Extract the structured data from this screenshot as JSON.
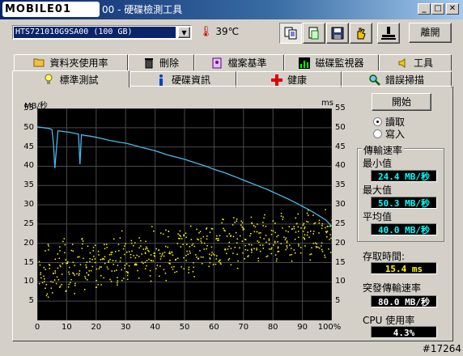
{
  "window": {
    "logo_text": "MOBILE01",
    "title_suffix": "00 - 硬碟檢測工具",
    "btn_min": "_",
    "btn_max": "□",
    "btn_close": "✕"
  },
  "toolbar": {
    "drive": "HTS721010G9SA00 (100 GB)",
    "temperature": "39",
    "temp_unit": "℃",
    "exit_label": "離開"
  },
  "tabs_top": [
    {
      "label": "資料夾使用率",
      "icon": "folder-icon"
    },
    {
      "label": "刪除",
      "icon": "trash-icon"
    },
    {
      "label": "檔案基準",
      "icon": "file-icon"
    },
    {
      "label": "磁碟監視器",
      "icon": "chart-icon"
    },
    {
      "label": "工具",
      "icon": "speaker-icon"
    }
  ],
  "tabs_bottom": [
    {
      "label": "標準測試",
      "icon": "bulb-icon",
      "active": true
    },
    {
      "label": "硬碟資訊",
      "icon": "info-icon"
    },
    {
      "label": "健康",
      "icon": "cross-icon"
    },
    {
      "label": "錯誤掃描",
      "icon": "magnifier-icon"
    }
  ],
  "controls": {
    "start_label": "開始",
    "read_label": "讀取",
    "write_label": "寫入",
    "mode_selected": "read"
  },
  "stats": {
    "transfer_title": "傳輸速率",
    "min_label": "最小值",
    "min_value": "24.4 MB/秒",
    "max_label": "最大值",
    "max_value": "50.3 MB/秒",
    "avg_label": "平均值",
    "avg_value": "40.0 MB/秒",
    "access_label": "存取時間:",
    "access_value": "15.4 ms",
    "burst_label": "突發傳輸速率",
    "burst_value": "80.0 MB/秒",
    "cpu_label": "CPU 使用率",
    "cpu_value": "4.3%"
  },
  "watermark": "#17264",
  "colors": {
    "transfer_line": "#4ab8e8",
    "access_points": "#ffff00",
    "grid": "#4a4a4a",
    "plot_bg": "#000000"
  },
  "chart_data": {
    "type": "line",
    "title": "",
    "ylabel_left": "MB/秒",
    "ylabel_right": "ms",
    "y_left_ticks": [
      5,
      10,
      15,
      20,
      25,
      30,
      35,
      40,
      45,
      50,
      55
    ],
    "y_right_ticks": [
      5,
      10,
      15,
      20,
      25,
      30,
      35,
      40,
      45,
      50,
      55
    ],
    "x_ticks": [
      "0",
      "10",
      "20",
      "30",
      "40",
      "50",
      "60",
      "70",
      "80",
      "90",
      "100%"
    ],
    "ylim": [
      0,
      55
    ],
    "xlim": [
      0,
      100
    ],
    "grid": true,
    "series": [
      {
        "name": "transfer_rate",
        "kind": "line",
        "x": [
          0,
          2,
          4,
          5,
          5.5,
          6,
          7,
          9,
          11,
          13,
          14,
          14.5,
          15,
          16,
          18,
          20,
          22,
          24,
          26,
          28,
          30,
          32,
          34,
          36,
          38,
          40,
          42,
          44,
          46,
          48,
          50,
          52,
          54,
          56,
          58,
          60,
          62,
          64,
          66,
          68,
          70,
          72,
          74,
          76,
          78,
          80,
          82,
          84,
          86,
          88,
          90,
          92,
          94,
          96,
          98,
          100
        ],
        "y": [
          50.2,
          50.0,
          49.8,
          49.5,
          46,
          39.5,
          49.2,
          49.0,
          48.8,
          48.5,
          48.3,
          40.5,
          48.2,
          48.0,
          47.8,
          47.5,
          47.2,
          46.8,
          46.5,
          46.2,
          46.0,
          45.6,
          45.2,
          44.8,
          44.4,
          44.0,
          43.5,
          43.0,
          42.6,
          42.2,
          41.8,
          41.3,
          40.8,
          40.3,
          39.8,
          39.2,
          38.7,
          38.2,
          37.6,
          37.0,
          36.4,
          35.8,
          35.2,
          34.6,
          34.0,
          33.3,
          32.6,
          31.9,
          31.2,
          30.4,
          29.6,
          28.8,
          27.9,
          27.0,
          26.0,
          24.4
        ]
      },
      {
        "name": "access_time",
        "kind": "scatter",
        "note_range": "approximately 5–25 ms spread, rising slightly with position",
        "x": [
          1,
          2,
          3,
          4,
          5,
          6,
          7,
          8,
          9,
          10,
          11,
          12,
          13,
          14,
          15,
          16,
          17,
          18,
          19,
          20,
          21,
          22,
          23,
          24,
          25,
          26,
          27,
          28,
          29,
          30,
          31,
          32,
          33,
          34,
          35,
          36,
          37,
          38,
          39,
          40,
          41,
          42,
          43,
          44,
          45,
          46,
          47,
          48,
          49,
          50,
          51,
          52,
          53,
          54,
          55,
          56,
          57,
          58,
          59,
          60,
          61,
          62,
          63,
          64,
          65,
          66,
          67,
          68,
          69,
          70,
          71,
          72,
          73,
          74,
          75,
          76,
          77,
          78,
          79,
          80,
          81,
          82,
          83,
          84,
          85,
          86,
          87,
          88,
          89,
          90,
          91,
          92,
          93,
          94,
          95,
          96,
          97,
          98,
          99,
          100
        ],
        "y": [
          12,
          14,
          9,
          16,
          11,
          13,
          15,
          10,
          18,
          12,
          14,
          16,
          11,
          13,
          17,
          12,
          15,
          14,
          19,
          13,
          16,
          12,
          18,
          15,
          14,
          17,
          13,
          20,
          15,
          16,
          14,
          18,
          17,
          15,
          19,
          16,
          18,
          14,
          20,
          17,
          16,
          19,
          15,
          21,
          18,
          17,
          16,
          20,
          18,
          19,
          17,
          21,
          16,
          20,
          19,
          18,
          22,
          17,
          20,
          19,
          21,
          18,
          22,
          20,
          19,
          21,
          23,
          18,
          22,
          20,
          21,
          19,
          23,
          21,
          20,
          22,
          24,
          19,
          21,
          23,
          20,
          22,
          24,
          21,
          23,
          20,
          22,
          24,
          22,
          21,
          23,
          25,
          20,
          24,
          22,
          23,
          21,
          25,
          23,
          22
        ]
      }
    ]
  }
}
